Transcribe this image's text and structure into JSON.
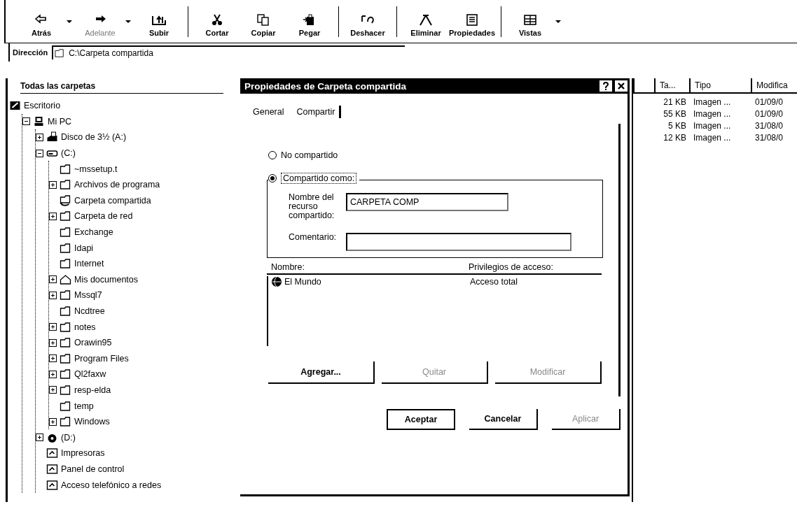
{
  "toolbar": {
    "buttons": [
      {
        "kind": "back",
        "label": "Atrás",
        "dropdown": true,
        "disabled": false
      },
      {
        "kind": "forward",
        "label": "Adelante",
        "dropdown": true,
        "disabled": true
      },
      {
        "kind": "up",
        "label": "Subir",
        "dropdown": false,
        "disabled": false
      },
      {
        "kind": "separator"
      },
      {
        "kind": "cut",
        "label": "Cortar",
        "dropdown": false,
        "disabled": false
      },
      {
        "kind": "copy",
        "label": "Copiar",
        "dropdown": false,
        "disabled": false
      },
      {
        "kind": "paste",
        "label": "Pegar",
        "dropdown": false,
        "disabled": false
      },
      {
        "kind": "separator"
      },
      {
        "kind": "undo",
        "label": "Deshacer",
        "dropdown": false,
        "disabled": false
      },
      {
        "kind": "separator"
      },
      {
        "kind": "delete",
        "label": "Eliminar",
        "dropdown": false,
        "disabled": false
      },
      {
        "kind": "properties",
        "label": "Propiedades",
        "dropdown": false,
        "disabled": false
      },
      {
        "kind": "separator"
      },
      {
        "kind": "views",
        "label": "Vistas",
        "dropdown": true,
        "disabled": false
      }
    ]
  },
  "address_bar": {
    "label": "Dirección",
    "value": "C:\\Carpeta compartida"
  },
  "folder_tree": {
    "title": "Todas las carpetas",
    "items": [
      {
        "label": "Escritorio",
        "kind": "desktop",
        "expandable": false,
        "children": [
          {
            "label": "Mi PC",
            "kind": "computer",
            "expandable": true,
            "expanded": true,
            "children": [
              {
                "label": "Disco de 3½ (A:)",
                "kind": "floppy",
                "expandable": true,
                "expanded": false
              },
              {
                "label": "(C:)",
                "kind": "drive",
                "expandable": true,
                "expanded": true,
                "children": [
                  {
                    "label": "~mssetup.t",
                    "kind": "folder",
                    "expandable": false
                  },
                  {
                    "label": "Archivos de programa",
                    "kind": "folder",
                    "expandable": true,
                    "expanded": false
                  },
                  {
                    "label": "Carpeta compartida",
                    "kind": "shared",
                    "expandable": false
                  },
                  {
                    "label": "Carpeta de red",
                    "kind": "folder",
                    "expandable": true,
                    "expanded": false
                  },
                  {
                    "label": "Exchange",
                    "kind": "folder",
                    "expandable": false
                  },
                  {
                    "label": "Idapi",
                    "kind": "folder",
                    "expandable": false
                  },
                  {
                    "label": "Internet",
                    "kind": "folder",
                    "expandable": false
                  },
                  {
                    "label": "Mis documentos",
                    "kind": "documents",
                    "expandable": true,
                    "expanded": false
                  },
                  {
                    "label": "Mssql7",
                    "kind": "folder",
                    "expandable": true,
                    "expanded": false
                  },
                  {
                    "label": "Ncdtree",
                    "kind": "folder",
                    "expandable": false
                  },
                  {
                    "label": "notes",
                    "kind": "folder",
                    "expandable": true,
                    "expanded": false
                  },
                  {
                    "label": "Orawin95",
                    "kind": "folder",
                    "expandable": true,
                    "expanded": false
                  },
                  {
                    "label": "Program Files",
                    "kind": "folder",
                    "expandable": true,
                    "expanded": false
                  },
                  {
                    "label": "Ql2faxw",
                    "kind": "folder",
                    "expandable": true,
                    "expanded": false
                  },
                  {
                    "label": "resp-elda",
                    "kind": "folder",
                    "expandable": true,
                    "expanded": false
                  },
                  {
                    "label": "temp",
                    "kind": "folder",
                    "expandable": false
                  },
                  {
                    "label": "Windows",
                    "kind": "folder",
                    "expandable": true,
                    "expanded": false
                  }
                ]
              },
              {
                "label": "(D:)",
                "kind": "cd",
                "expandable": true,
                "expanded": false
              },
              {
                "label": "Impresoras",
                "kind": "system",
                "expandable": false
              },
              {
                "label": "Panel de control",
                "kind": "system",
                "expandable": false
              },
              {
                "label": "Acceso telefónico a redes",
                "kind": "system",
                "expandable": false
              }
            ]
          }
        ]
      }
    ]
  },
  "file_list": {
    "columns": [
      "Ta...",
      "Tipo",
      "Modifica"
    ],
    "rows": [
      [
        "21 KB",
        "Imagen ...",
        "01/09/0"
      ],
      [
        "55 KB",
        "Imagen ...",
        "01/09/0"
      ],
      [
        "5 KB",
        "Imagen ...",
        "31/08/0"
      ],
      [
        "12 KB",
        "Imagen ...",
        "31/08/0"
      ]
    ]
  },
  "dialog": {
    "title": "Propiedades de Carpeta compartida",
    "tabs": [
      {
        "label": "General",
        "selected": false
      },
      {
        "label": "Compartir",
        "selected": true
      }
    ],
    "options": [
      {
        "label": "No compartido",
        "selected": false
      },
      {
        "label": "Compartido como:",
        "selected": true
      }
    ],
    "fields": [
      {
        "label": "Nombre del recurso compartido:",
        "value": "CARPETA COMP"
      },
      {
        "label": "Comentario:"
      }
    ],
    "permissions": {
      "columns": [
        "Nombre:",
        "Privilegios de acceso:"
      ],
      "rows": [
        {
          "name": "El Mundo",
          "access": "Acceso total"
        }
      ]
    },
    "list_buttons": [
      {
        "label": "Agregar...",
        "disabled": false
      },
      {
        "label": "Quitar",
        "disabled": true
      },
      {
        "label": "Modificar",
        "disabled": true
      }
    ],
    "buttons": [
      {
        "label": "Aceptar",
        "disabled": false,
        "default": true
      },
      {
        "label": "Cancelar",
        "disabled": false,
        "default": false
      },
      {
        "label": "Aplicar",
        "disabled": true,
        "default": false
      }
    ]
  }
}
